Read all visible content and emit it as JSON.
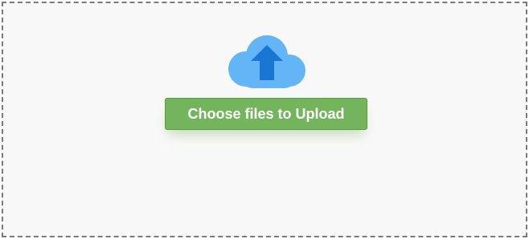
{
  "dropzone": {
    "icon": "cloud-upload-icon",
    "button_label": "Choose files to Upload"
  },
  "colors": {
    "cloud": "#64b5f6",
    "arrow": "#1976d2",
    "button": "#74b45c",
    "border": "#7a7a7a",
    "background": "#f8f8f8"
  }
}
